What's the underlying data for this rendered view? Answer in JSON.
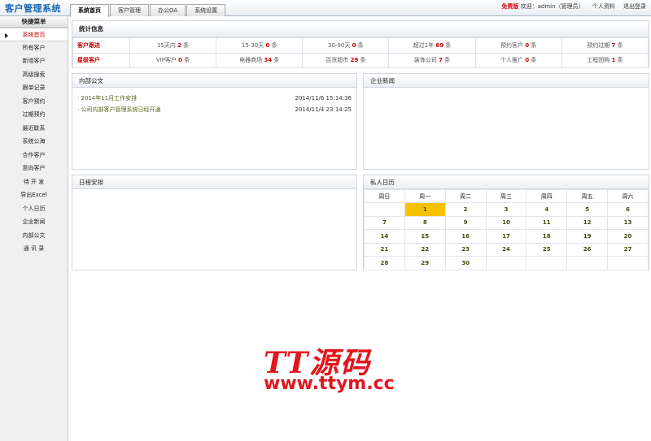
{
  "header": {
    "app_title": "客户管理系统",
    "tabs": [
      {
        "label": "系统首页",
        "active": true
      },
      {
        "label": "客户管理",
        "active": false
      },
      {
        "label": "办公OA",
        "active": false
      },
      {
        "label": "系统设置",
        "active": false
      }
    ],
    "free_label": "免费版",
    "welcome": "欢迎：admin（管理员）",
    "profile_link": "个人资料",
    "logout_link": "退出登录"
  },
  "sidebar": {
    "heading": "快捷菜单",
    "items": [
      {
        "label": "系统首页",
        "active": true
      },
      {
        "label": "所有客户"
      },
      {
        "label": "新增客户"
      },
      {
        "label": "高级搜索"
      },
      {
        "label": "跟单记录"
      },
      {
        "label": "客户预约"
      },
      {
        "label": "过期预约"
      },
      {
        "label": "最近联系"
      },
      {
        "label": "系统公海"
      },
      {
        "label": "合作客户"
      },
      {
        "label": "意向客户"
      },
      {
        "label": "待 开 发"
      },
      {
        "label": "导出Excel"
      },
      {
        "label": "个人日历"
      },
      {
        "label": "企业新闻"
      },
      {
        "label": "内部公文"
      },
      {
        "label": "通 讯 录"
      }
    ]
  },
  "stats": {
    "title": "统计信息",
    "rows": [
      {
        "label": "客户跟进",
        "cells": [
          {
            "prefix": "15天内",
            "value": "2",
            "unit": "条"
          },
          {
            "prefix": "15-30天",
            "value": "0",
            "unit": "条"
          },
          {
            "prefix": "30-90天",
            "value": "0",
            "unit": "条"
          },
          {
            "prefix": "超过1年",
            "value": "69",
            "unit": "条"
          },
          {
            "prefix": "预约客户",
            "value": "0",
            "unit": "条"
          },
          {
            "prefix": "预约过期",
            "value": "7",
            "unit": "条"
          }
        ]
      },
      {
        "label": "星级客户",
        "cells": [
          {
            "prefix": "VIP客户",
            "value": "0",
            "unit": "条"
          },
          {
            "prefix": "电器商场",
            "value": "34",
            "unit": "条"
          },
          {
            "prefix": "百货超市",
            "value": "29",
            "unit": "条"
          },
          {
            "prefix": "装饰公司",
            "value": "7",
            "unit": "条"
          },
          {
            "prefix": "个人推广",
            "value": "0",
            "unit": "条"
          },
          {
            "prefix": "工程团购",
            "value": "1",
            "unit": "条"
          }
        ]
      }
    ]
  },
  "internal_docs": {
    "title": "内部公文",
    "items": [
      {
        "title": "· 2014年11月工作安排",
        "date": "2014/11/6 15:14:36"
      },
      {
        "title": "· 公司内部客户管理系统已经开通",
        "date": "2014/11/4 23:14:25"
      }
    ]
  },
  "company_news": {
    "title": "企业新闻"
  },
  "schedule": {
    "title": "日程安排"
  },
  "calendar": {
    "title": "私人日历",
    "weekdays": [
      "周日",
      "周一",
      "周二",
      "周三",
      "周四",
      "周五",
      "周六"
    ],
    "weeks": [
      [
        "",
        "1",
        "2",
        "3",
        "4",
        "5",
        "6"
      ],
      [
        "7",
        "8",
        "9",
        "10",
        "11",
        "12",
        "13"
      ],
      [
        "14",
        "15",
        "16",
        "17",
        "18",
        "19",
        "20"
      ],
      [
        "21",
        "22",
        "23",
        "24",
        "25",
        "26",
        "27"
      ],
      [
        "28",
        "29",
        "30",
        "",
        "",
        "",
        ""
      ]
    ],
    "today": "1",
    "today_color": "#f5c200"
  },
  "watermark": {
    "line1": "TT源码",
    "line2": "www.ttym.cc"
  },
  "colors": {
    "accent_red": "#cc0000",
    "brand_blue": "#1a64b0",
    "watermark_red": "#e3151d"
  }
}
